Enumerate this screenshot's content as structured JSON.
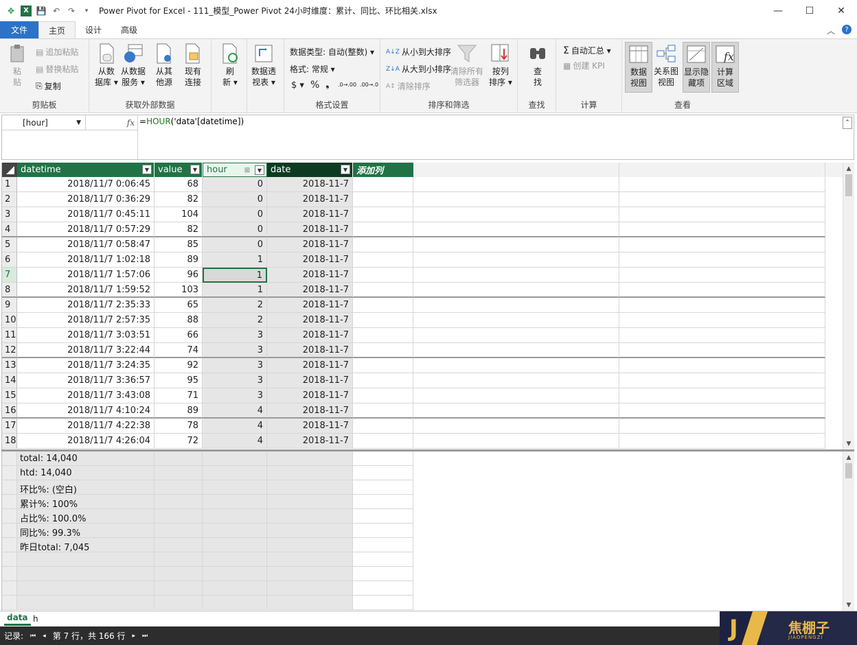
{
  "window": {
    "title": "Power Pivot for Excel - 111_模型_Power Pivot 24小时维度：累计、同比、环比相关.xlsx",
    "minimize": "—",
    "maximize": "☐",
    "close": "✕"
  },
  "tabs": [
    "文件",
    "主页",
    "设计",
    "高级"
  ],
  "ribbon": {
    "clipboard": {
      "label": "剪贴板",
      "paste": "粘\n贴",
      "append_paste": "追加粘贴",
      "replace_paste": "替换粘贴",
      "copy": "复制"
    },
    "external": {
      "label": "获取外部数据",
      "from_db": "从数\n据库 ▾",
      "from_service": "从数据\n服务 ▾",
      "from_other": "从其\n他源",
      "existing": "现有\n连接"
    },
    "refresh": {
      "label": "刷\n新 ▾"
    },
    "pivot": {
      "label": "数据透\n视表 ▾"
    },
    "format": {
      "label": "格式设置",
      "data_type": "数据类型: 自动(整数) ▾",
      "format": "格式: 常规 ▾",
      "currency": "$ ▾",
      "percent": "%",
      "comma": "❟",
      "inc": ".0→.00",
      "dec": ".00→.0"
    },
    "sort": {
      "label": "排序和筛选",
      "asc": "从小到大排序",
      "desc": "从大到小排序",
      "clear_sort": "清除排序",
      "clear_filter": "清除所有\n筛选器",
      "sort_by": "按列\n排序 ▾"
    },
    "find": {
      "label": "查找",
      "btn": "查\n找"
    },
    "calc": {
      "label": "计算",
      "autosum": "自动汇总 ▾",
      "kpi": "创建 KPI"
    },
    "view": {
      "label": "查看",
      "data_view": "数据\n视图",
      "diagram": "关系图\n视图",
      "hidden": "显示隐\n藏项",
      "calc_area": "计算\n区域"
    }
  },
  "formula_bar": {
    "name": "[hour]",
    "fx": "fx",
    "formula_prefix": "=",
    "formula_fn": "HOUR",
    "formula_rest": "('data'[datetime])"
  },
  "columns": [
    "datetime",
    "value",
    "hour",
    "date",
    "添加列"
  ],
  "rows": [
    [
      "1",
      "2018/11/7 0:06:45",
      "68",
      "0",
      "2018-11-7"
    ],
    [
      "2",
      "2018/11/7 0:36:29",
      "82",
      "0",
      "2018-11-7"
    ],
    [
      "3",
      "2018/11/7 0:45:11",
      "104",
      "0",
      "2018-11-7"
    ],
    [
      "4",
      "2018/11/7 0:57:29",
      "82",
      "0",
      "2018-11-7"
    ],
    [
      "5",
      "2018/11/7 0:58:47",
      "85",
      "0",
      "2018-11-7"
    ],
    [
      "6",
      "2018/11/7 1:02:18",
      "89",
      "1",
      "2018-11-7"
    ],
    [
      "7",
      "2018/11/7 1:57:06",
      "96",
      "1",
      "2018-11-7"
    ],
    [
      "8",
      "2018/11/7 1:59:52",
      "103",
      "1",
      "2018-11-7"
    ],
    [
      "9",
      "2018/11/7 2:35:33",
      "65",
      "2",
      "2018-11-7"
    ],
    [
      "10",
      "2018/11/7 2:57:35",
      "88",
      "2",
      "2018-11-7"
    ],
    [
      "11",
      "2018/11/7 3:03:51",
      "66",
      "3",
      "2018-11-7"
    ],
    [
      "12",
      "2018/11/7 3:22:44",
      "74",
      "3",
      "2018-11-7"
    ],
    [
      "13",
      "2018/11/7 3:24:35",
      "92",
      "3",
      "2018-11-7"
    ],
    [
      "14",
      "2018/11/7 3:36:57",
      "95",
      "3",
      "2018-11-7"
    ],
    [
      "15",
      "2018/11/7 3:43:08",
      "71",
      "3",
      "2018-11-7"
    ],
    [
      "16",
      "2018/11/7 4:10:24",
      "89",
      "4",
      "2018-11-7"
    ],
    [
      "17",
      "2018/11/7 4:22:38",
      "78",
      "4",
      "2018-11-7"
    ],
    [
      "18",
      "2018/11/7 4:26:04",
      "72",
      "4",
      "2018-11-7"
    ]
  ],
  "measures": [
    "total: 14,040",
    "htd: 14,040",
    "环比%: (空白)",
    "累计%: 100%",
    "占比%: 100.0%",
    "同比%: 99.3%",
    "昨日total: 7,045"
  ],
  "sheets": [
    "data",
    "h"
  ],
  "status": {
    "record": "记录:",
    "first": "⏮",
    "prev": "◂",
    "position": "第 7 行，共 166 行",
    "next": "▸",
    "last": "⏭"
  },
  "logo": {
    "cn": "焦棚子",
    "en": "JIAOPENGZI",
    "letter": "J"
  },
  "colors": {
    "header_green": "#217346",
    "header_dark": "#0d3b22",
    "file_tab": "#2b73c6"
  }
}
